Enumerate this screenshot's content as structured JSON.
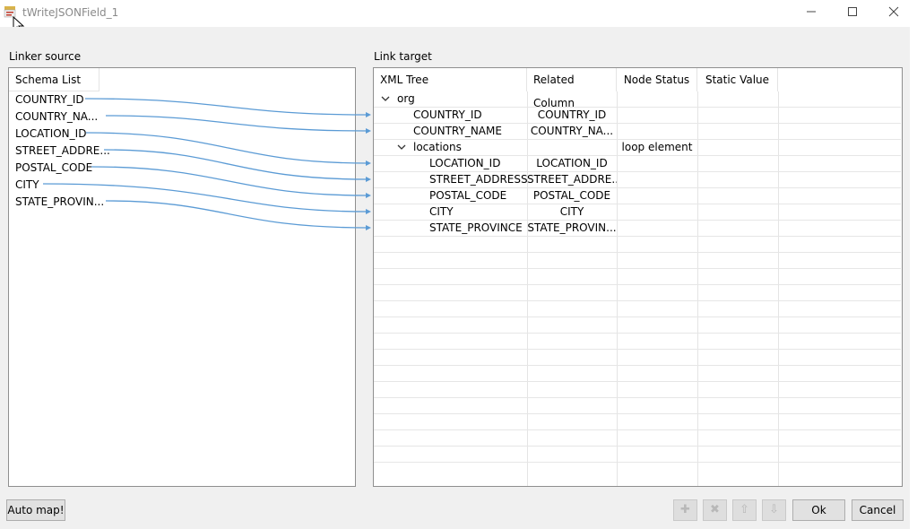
{
  "window": {
    "title": "tWriteJSONField_1",
    "minimize_icon": "minimize-icon",
    "maximize_icon": "maximize-icon",
    "close_icon": "close-icon"
  },
  "linker_source": {
    "label": "Linker source",
    "header": "Schema List",
    "items": [
      "COUNTRY_ID",
      "COUNTRY_NA...",
      "LOCATION_ID",
      "STREET_ADDRE...",
      "POSTAL_CODE",
      "CITY",
      "STATE_PROVIN..."
    ]
  },
  "link_target": {
    "label": "Link target",
    "headers": [
      "XML Tree",
      "Related Column",
      "Node Status",
      "Static Value"
    ],
    "rows": [
      {
        "name": "org",
        "related": "",
        "status": "",
        "expander": "chevron-down-icon"
      },
      {
        "name": "COUNTRY_ID",
        "related": "COUNTRY_ID",
        "status": ""
      },
      {
        "name": "COUNTRY_NAME",
        "related": "COUNTRY_NA...",
        "status": ""
      },
      {
        "name": "locations",
        "related": "",
        "status": "loop element",
        "expander": "chevron-down-icon"
      },
      {
        "name": "LOCATION_ID",
        "related": "LOCATION_ID",
        "status": ""
      },
      {
        "name": "STREET_ADDRESS",
        "related": "STREET_ADDRE...",
        "status": ""
      },
      {
        "name": "POSTAL_CODE",
        "related": "POSTAL_CODE",
        "status": ""
      },
      {
        "name": "CITY",
        "related": "CITY",
        "status": ""
      },
      {
        "name": "STATE_PROVINCE",
        "related": "STATE_PROVIN...",
        "status": ""
      }
    ]
  },
  "buttons": {
    "auto_map": "Auto map!",
    "ok": "Ok",
    "cancel": "Cancel",
    "icons": [
      "add-icon",
      "delete-icon",
      "move-up-icon",
      "move-down-icon"
    ]
  },
  "colors": {
    "link_line": "#5b9bd5",
    "panel_border": "#8f8f8f",
    "background": "#f0f0f0"
  }
}
